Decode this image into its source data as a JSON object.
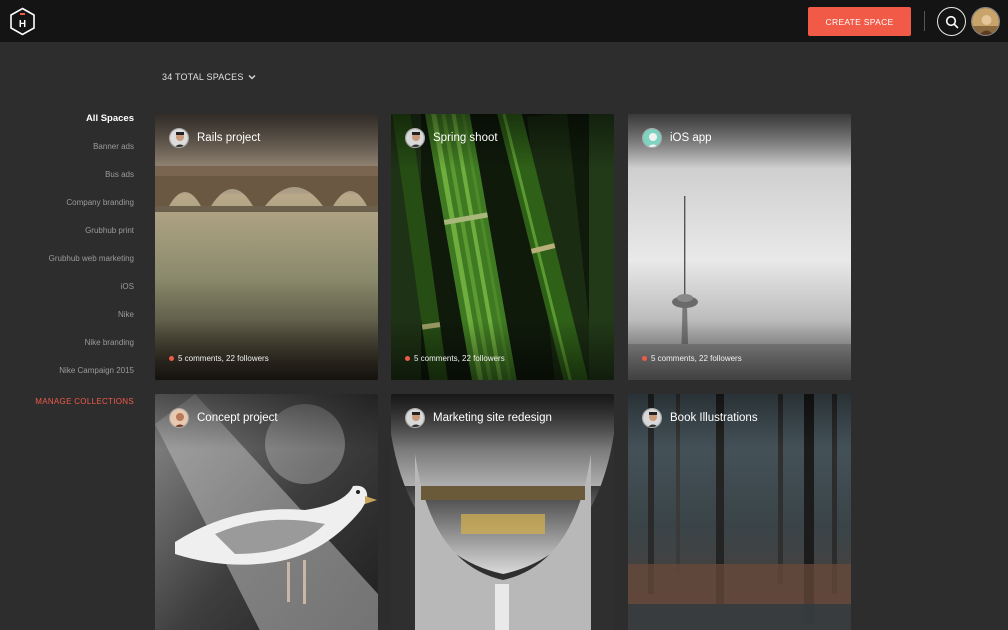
{
  "header": {
    "logo_letter": "H",
    "create_label": "CREATE SPACE"
  },
  "summary": {
    "total_label": "34 TOTAL SPACES"
  },
  "sidebar": {
    "items": [
      {
        "label": "All Spaces",
        "active": true
      },
      {
        "label": "Banner ads"
      },
      {
        "label": "Bus ads"
      },
      {
        "label": "Company branding"
      },
      {
        "label": "Grubhub print"
      },
      {
        "label": "Grubhub web marketing"
      },
      {
        "label": "iOS"
      },
      {
        "label": "Nike"
      },
      {
        "label": "Nike branding"
      },
      {
        "label": "Nike Campaign 2015"
      }
    ],
    "manage_label": "MANAGE COLLECTIONS"
  },
  "cards": [
    {
      "title": "Rails project",
      "meta": "5 comments, 22 followers"
    },
    {
      "title": "Spring shoot",
      "meta": "5 comments, 22 followers"
    },
    {
      "title": "iOS app",
      "meta": "5 comments, 22 followers"
    },
    {
      "title": "Concept project"
    },
    {
      "title": "Marketing site redesign"
    },
    {
      "title": "Book Illustrations"
    }
  ],
  "colors": {
    "accent": "#f05a47",
    "background": "#2d2d2d",
    "topbar": "#141414"
  }
}
